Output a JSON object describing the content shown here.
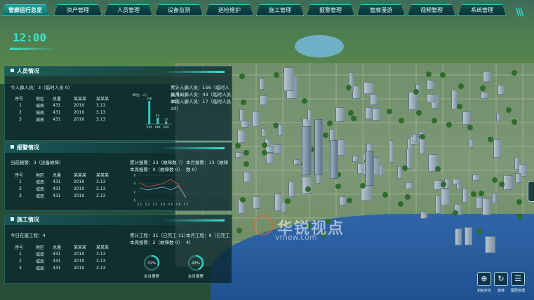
{
  "nav": {
    "tabs": [
      {
        "label": "管廊运行总览",
        "active": true
      },
      {
        "label": "资产管理"
      },
      {
        "label": "人员管理"
      },
      {
        "label": "设备监测"
      },
      {
        "label": "巡检维护"
      },
      {
        "label": "施工管理"
      },
      {
        "label": "报警管理"
      },
      {
        "label": "管廊漫游"
      },
      {
        "label": "视频管理"
      },
      {
        "label": "系统管理"
      }
    ]
  },
  "clock": {
    "time": "12:00"
  },
  "watermark": {
    "text": "华锐视点",
    "url": "vrnew.com"
  },
  "personnel": {
    "title": "人员情况",
    "today_in": "今入廊人员：3（临时人员 0）",
    "stats": {
      "total": "累计入廊人员：156（临时人员 56）",
      "month": "本月入廊人员：43（临时人员 10）",
      "week": "本周入廊人员：17（临时人员 20）"
    },
    "table": {
      "headers": [
        "序号",
        "地区",
        "总量",
        "某某某",
        "某某某"
      ],
      "rows": [
        [
          "1",
          "城南",
          "431",
          "2010",
          "3.13"
        ],
        [
          "2",
          "城南",
          "431",
          "2010",
          "3.13"
        ],
        [
          "3",
          "城南",
          "431",
          "2010",
          "3.13"
        ]
      ]
    },
    "chart_unit": "（单位：人）"
  },
  "alarms": {
    "title": "报警情况",
    "current": "当前报警：3（设备故障）",
    "total": "累计报警：23（故障数 7）",
    "month": "本月报警：13（故障数 0）",
    "week": "本周报警：0（故障数 0）",
    "table": {
      "headers": [
        "序号",
        "地区",
        "总量",
        "某某某",
        "某某某"
      ],
      "rows": [
        [
          "1",
          "城南",
          "431",
          "2010",
          "3.13"
        ],
        [
          "2",
          "城南",
          "431",
          "2010",
          "3.13"
        ],
        [
          "3",
          "城南",
          "431",
          "2010",
          "3.13"
        ]
      ]
    }
  },
  "construction": {
    "title": "施工情况",
    "today": "今日在建工程：4",
    "total": "累计工程：31（已完工 11）",
    "month": "本月工程：9（已完工 4）",
    "week": "本周报警：2（故障数 0）",
    "table": {
      "headers": [
        "序号",
        "地区",
        "总量",
        "某某某",
        "某某某"
      ],
      "rows": [
        [
          "1",
          "城南",
          "431",
          "2010",
          "3.13"
        ],
        [
          "2",
          "城南",
          "431",
          "2010",
          "3.13"
        ],
        [
          "3",
          "城南",
          "431",
          "2010",
          "3.13"
        ]
      ]
    },
    "donuts": [
      {
        "value": "31%",
        "fraction": 0.31,
        "label": "本月报警"
      },
      {
        "value": "43%",
        "fraction": 0.43,
        "label": "本月报警"
      }
    ]
  },
  "controls": [
    {
      "icon": "target-icon",
      "label": "初始定位"
    },
    {
      "icon": "rotate-icon",
      "label": "旋转"
    },
    {
      "icon": "layers-icon",
      "label": "图层管理"
    }
  ],
  "chart_data": [
    {
      "type": "bar",
      "categories": [
        "XXX",
        "XXX",
        "XXX"
      ],
      "values": [
        156,
        43,
        17
      ],
      "ylabel": "（单位：人）",
      "ylim": [
        0,
        180
      ],
      "color": "#2fd0c4"
    },
    {
      "type": "line",
      "x": [
        "5.1",
        "5.2",
        "5.3",
        "5.4",
        "5.5",
        "5.6",
        "5.7"
      ],
      "series": [
        {
          "values": [
            4.2,
            3.3,
            3.6,
            4.0,
            5.0,
            3.8,
            0.5
          ],
          "color": "#d94a4a"
        },
        {
          "values": [
            3.0,
            2.5,
            2.8,
            3.2,
            2.5,
            3.4,
            0.8
          ],
          "color": "#7fb6d8"
        }
      ],
      "yticks": [
        0,
        2,
        4,
        6
      ],
      "ylim": [
        0,
        6
      ]
    }
  ]
}
